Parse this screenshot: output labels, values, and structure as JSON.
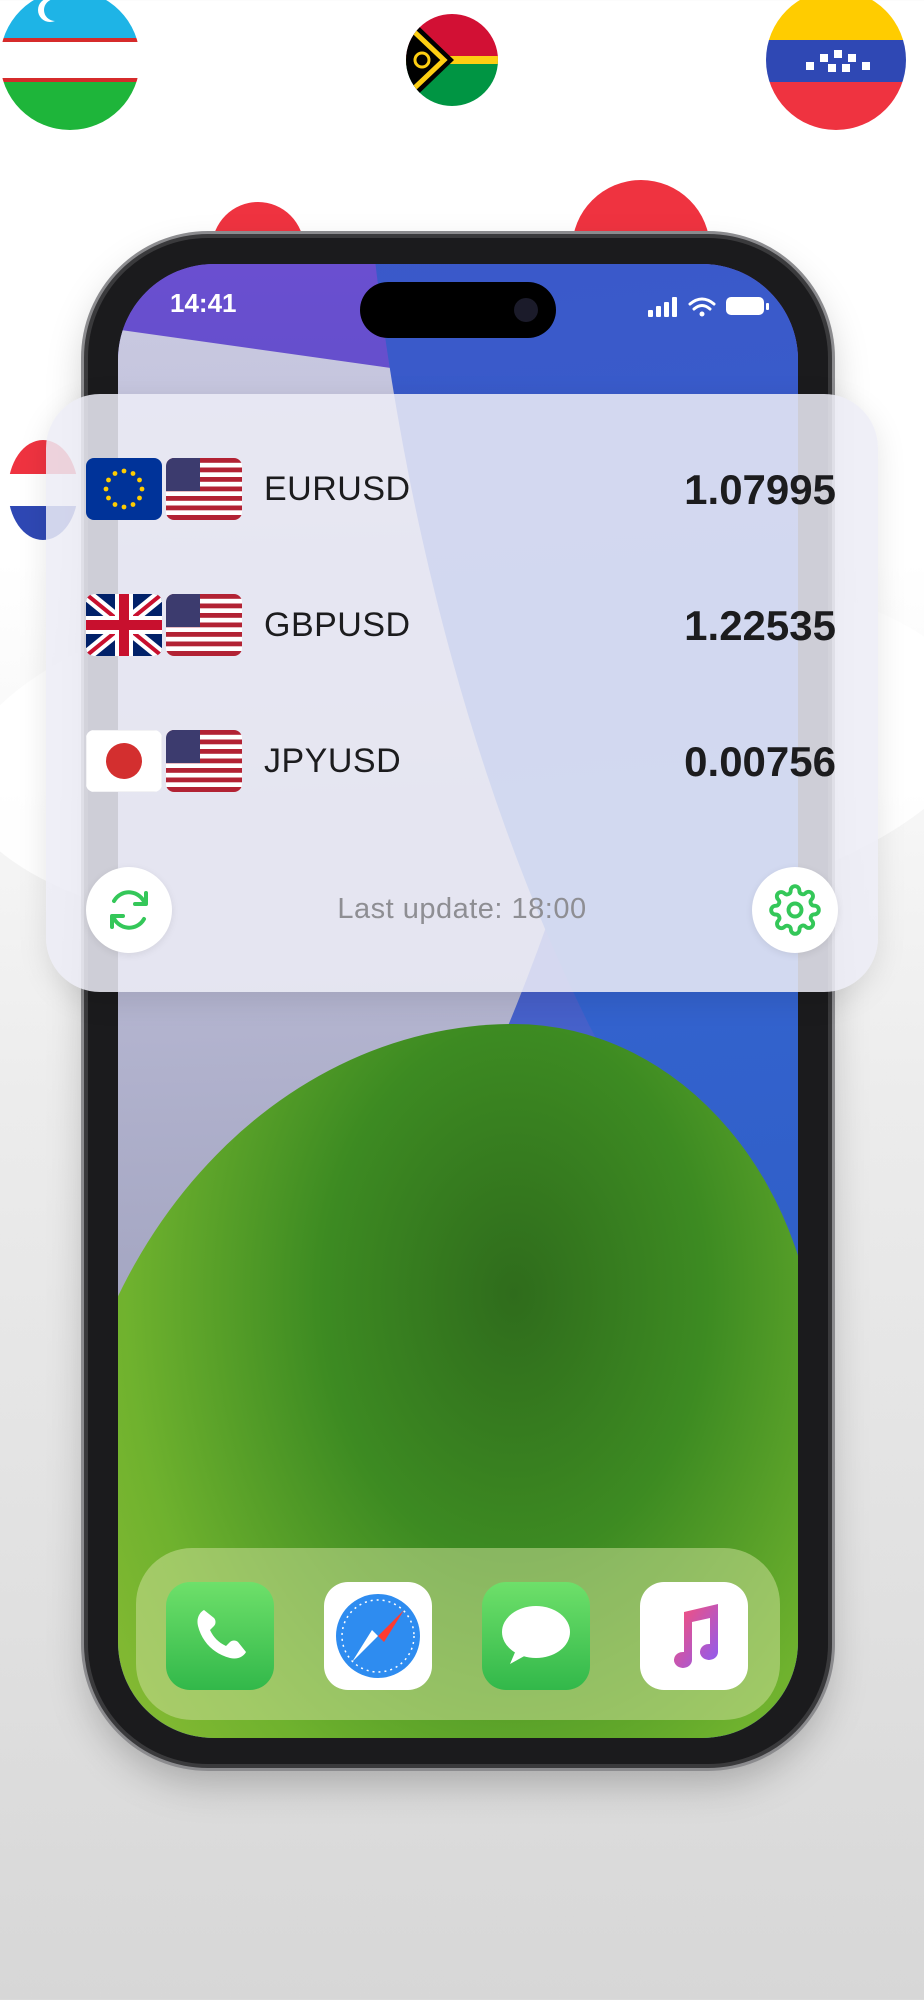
{
  "status_bar": {
    "time": "14:41"
  },
  "widget": {
    "rows": [
      {
        "pair": "EURUSD",
        "rate": "1.07995",
        "base_flag": "eu-flag-icon",
        "quote_flag": "us-flag-icon"
      },
      {
        "pair": "GBPUSD",
        "rate": "1.22535",
        "base_flag": "uk-flag-icon",
        "quote_flag": "us-flag-icon"
      },
      {
        "pair": "JPYUSD",
        "rate": "0.00756",
        "base_flag": "japan-flag-icon",
        "quote_flag": "us-flag-icon"
      }
    ],
    "last_update": "Last update: 18:00",
    "refresh_icon": "refresh-icon",
    "settings_icon": "gear-icon",
    "accent": "#34c759"
  },
  "dock": {
    "apps": [
      "phone-app-icon",
      "safari-app-icon",
      "messages-app-icon",
      "music-app-icon"
    ]
  },
  "decorative_flags": [
    "uzbekistan-flag-icon",
    "vanuatu-flag-icon",
    "venezuela-flag-icon"
  ]
}
